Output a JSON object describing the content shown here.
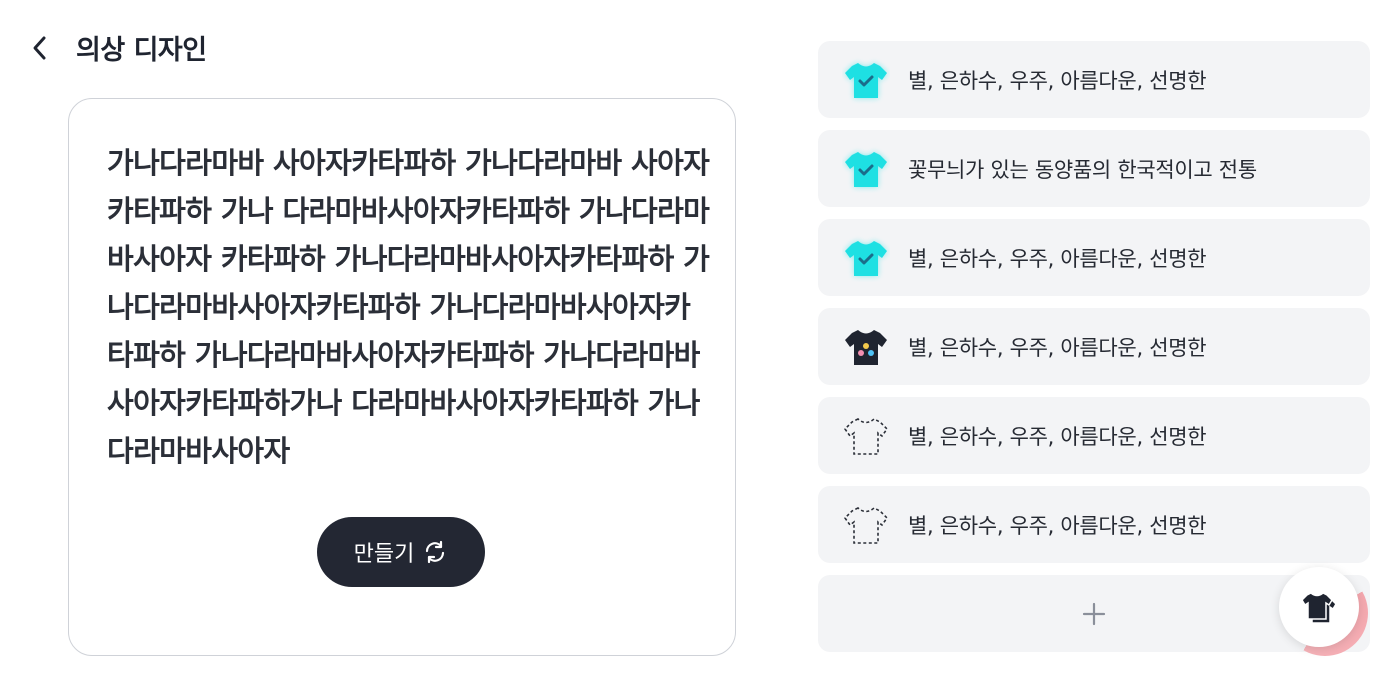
{
  "header": {
    "back_icon": "chevron-left-icon",
    "title": "의상 디자인"
  },
  "editor": {
    "text": "가나다라마바 사아자카타파하 가나다라마바 사아자카타파하 가나 다라마바사아자카타파하 가나다라마바사아자 카타파하 가나다라마바사아자카타파하 가나다라마바사아자카타파하 가나다라마바사아자카타파하 가나다라마바사아자카타파하 가나다라마바 사아자카타파하가나 다라마바사아자카타파하 가나다라마바사아자",
    "make_button_label": "만들기",
    "make_button_icon": "refresh-icon"
  },
  "designs": [
    {
      "label": "별, 은하수, 우주, 아름다운, 선명한",
      "icon": "tshirt-check-cyan-icon"
    },
    {
      "label": "꽃무늬가 있는 동양품의 한국적이고 전통",
      "icon": "tshirt-check-cyan-icon"
    },
    {
      "label": "별, 은하수, 우주, 아름다운, 선명한",
      "icon": "tshirt-check-cyan-icon"
    },
    {
      "label": "별, 은하수, 우주, 아름다운, 선명한",
      "icon": "tshirt-dark-dots-icon"
    },
    {
      "label": "별, 은하수, 우주, 아름다운, 선명한",
      "icon": "tshirt-dashed-outline-icon"
    },
    {
      "label": "별, 은하수, 우주, 아름다운, 선명한",
      "icon": "tshirt-dashed-outline-icon"
    }
  ],
  "add_button_icon": "plus-icon",
  "fab_icon": "stacked-shirts-icon",
  "colors": {
    "accent_cyan": "#1ee0e3",
    "dark": "#232733",
    "item_bg": "#f3f4f6",
    "fab_ring": "#f4a7ae"
  }
}
